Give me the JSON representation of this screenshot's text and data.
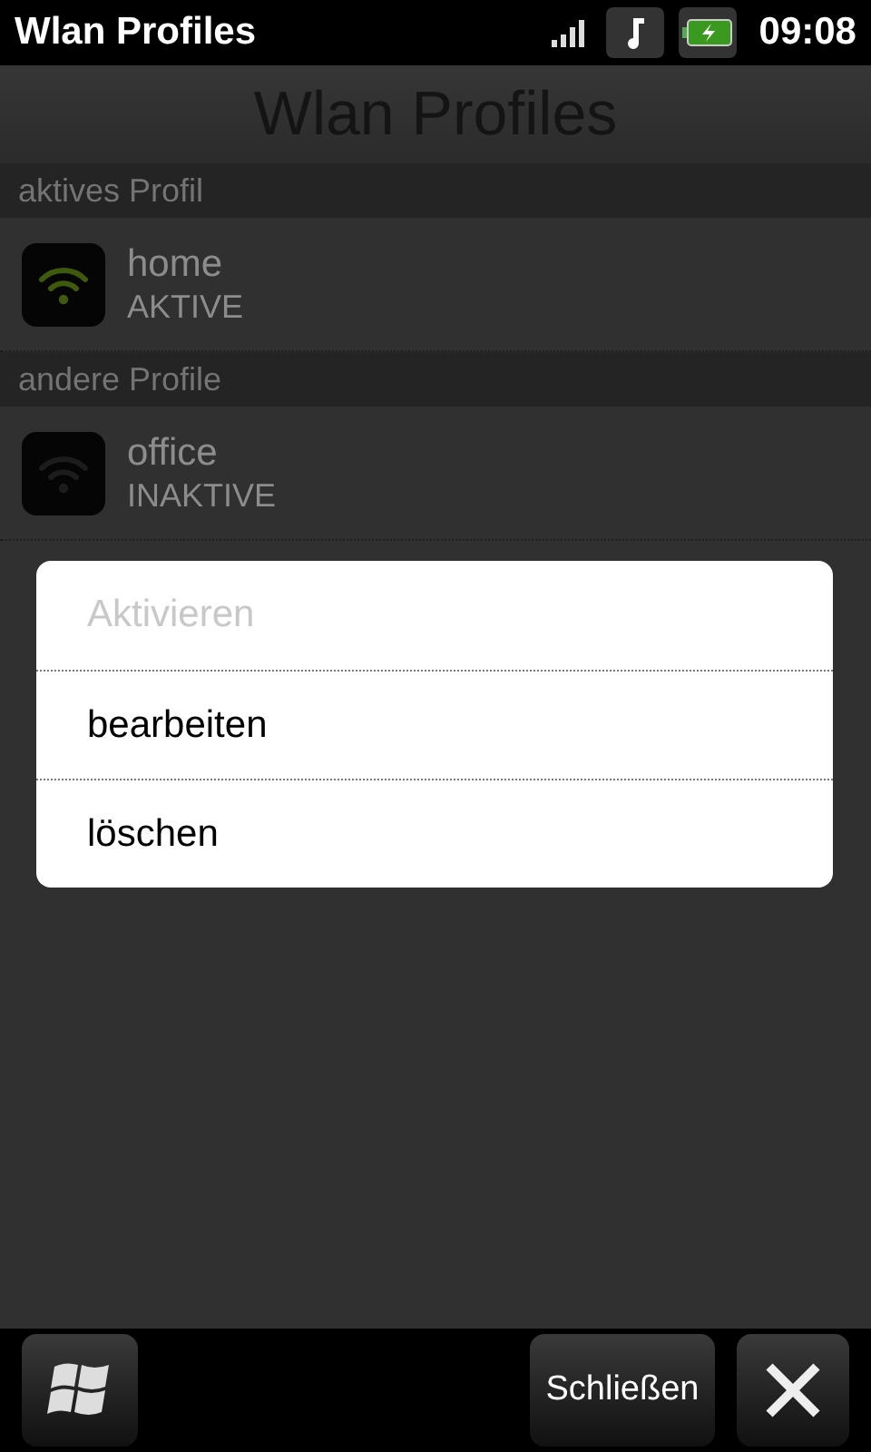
{
  "status_bar": {
    "title": "Wlan Profiles",
    "time": "09:08"
  },
  "header": {
    "title": "Wlan Profiles"
  },
  "sections": [
    {
      "header": "aktives Profil",
      "profiles": [
        {
          "name": "home",
          "status": "AKTIVE",
          "connected": true
        }
      ]
    },
    {
      "header": "andere Profile",
      "profiles": [
        {
          "name": "office",
          "status": "INAKTIVE",
          "connected": false
        }
      ]
    }
  ],
  "menu": {
    "items": [
      {
        "label": "Aktivieren",
        "disabled": true
      },
      {
        "label": "bearbeiten",
        "disabled": false
      },
      {
        "label": "löschen",
        "disabled": false
      }
    ]
  },
  "soft_keys": {
    "center": "Schließen"
  }
}
